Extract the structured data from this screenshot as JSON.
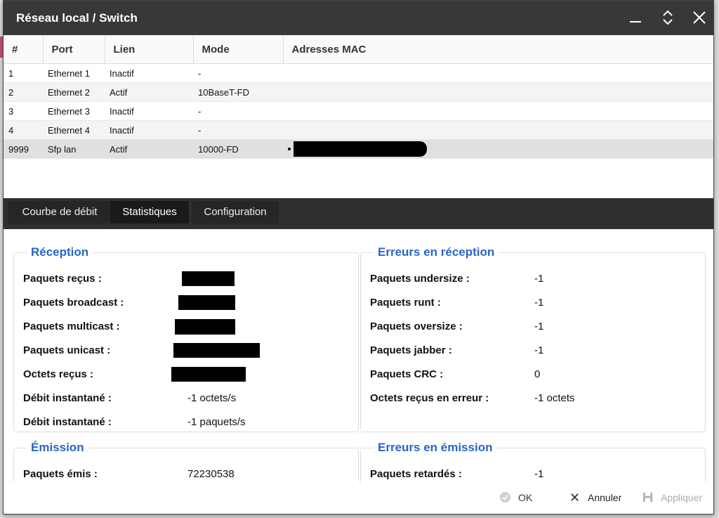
{
  "window": {
    "title": "Réseau local / Switch"
  },
  "table": {
    "headers": [
      "#",
      "Port",
      "Lien",
      "Mode",
      "Adresses MAC"
    ],
    "rows": [
      {
        "num": "1",
        "port": "Ethernet 1",
        "link": "Inactif",
        "mode": "-",
        "mac": ""
      },
      {
        "num": "2",
        "port": "Ethernet 2",
        "link": "Actif",
        "mode": "10BaseT-FD",
        "mac": ""
      },
      {
        "num": "3",
        "port": "Ethernet 3",
        "link": "Inactif",
        "mode": "-",
        "mac": ""
      },
      {
        "num": "4",
        "port": "Ethernet 4",
        "link": "Inactif",
        "mode": "-",
        "mac": ""
      },
      {
        "num": "9999",
        "port": "Sfp lan",
        "link": "Actif",
        "mode": "10000-FD",
        "mac": "redacted"
      }
    ]
  },
  "tabs": [
    "Courbe de débit",
    "Statistiques",
    "Configuration"
  ],
  "reception": {
    "title": "Réception",
    "rows": [
      {
        "label": "Paquets reçus :",
        "value": "redacted"
      },
      {
        "label": "Paquets broadcast :",
        "value": "redacted"
      },
      {
        "label": "Paquets multicast :",
        "value": "redacted"
      },
      {
        "label": "Paquets unicast :",
        "value": "redacted"
      },
      {
        "label": "Octets reçus :",
        "value": "redacted"
      },
      {
        "label": "Débit instantané :",
        "value": "-1 octets/s"
      },
      {
        "label": "Débit instantané :",
        "value": "-1 paquets/s"
      }
    ]
  },
  "rx_errors": {
    "title": "Erreurs en réception",
    "rows": [
      {
        "label": "Paquets undersize :",
        "value": "-1"
      },
      {
        "label": "Paquets runt :",
        "value": "-1"
      },
      {
        "label": "Paquets oversize :",
        "value": "-1"
      },
      {
        "label": "Paquets jabber :",
        "value": "-1"
      },
      {
        "label": "Paquets CRC :",
        "value": "0"
      },
      {
        "label": "Octets reçus en erreur :",
        "value": "-1 octets"
      }
    ]
  },
  "emission": {
    "title": "Émission",
    "rows": [
      {
        "label": "Paquets émis :",
        "value": "72230538"
      }
    ]
  },
  "tx_errors": {
    "title": "Erreurs en émission",
    "rows": [
      {
        "label": "Paquets retardés :",
        "value": "-1"
      }
    ]
  },
  "footer": {
    "ok": "OK",
    "cancel": "Annuler",
    "apply": "Appliquer"
  },
  "colors": {
    "titlebar": "#383838",
    "section_title": "#2766c6",
    "tabbar": "#2f2f2f"
  }
}
